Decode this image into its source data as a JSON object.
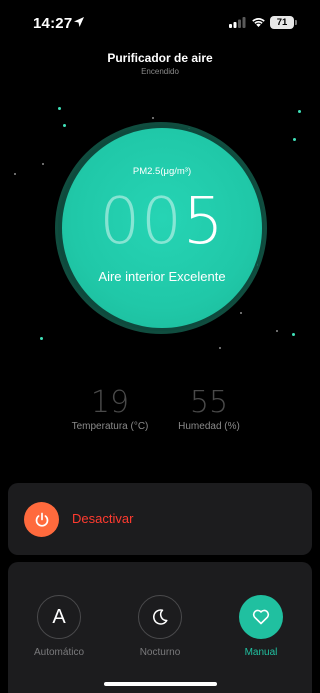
{
  "status_bar": {
    "time": "14:27",
    "battery": "71"
  },
  "header": {
    "title": "Purificador de aire",
    "subtitle": "Encendido"
  },
  "gauge": {
    "label": "PM2.5(μg/m³)",
    "value_dim": "00",
    "value_bright": "5",
    "status": "Aire interior Excelente",
    "color": "#20c8a8"
  },
  "stats": {
    "temperature": {
      "value": "19",
      "label": "Temperatura (°C)"
    },
    "humidity": {
      "value": "55",
      "label": "Humedad (%)"
    }
  },
  "power": {
    "label": "Desactivar",
    "icon": "power-icon",
    "color": "#ff6a3d"
  },
  "modes": {
    "items": [
      {
        "label": "Automático",
        "icon": "letter-a-icon",
        "glyph": "A",
        "active": false
      },
      {
        "label": "Nocturno",
        "icon": "moon-icon",
        "active": false
      },
      {
        "label": "Manual",
        "icon": "heart-icon",
        "active": true
      }
    ],
    "accent": "#20c0a0"
  }
}
